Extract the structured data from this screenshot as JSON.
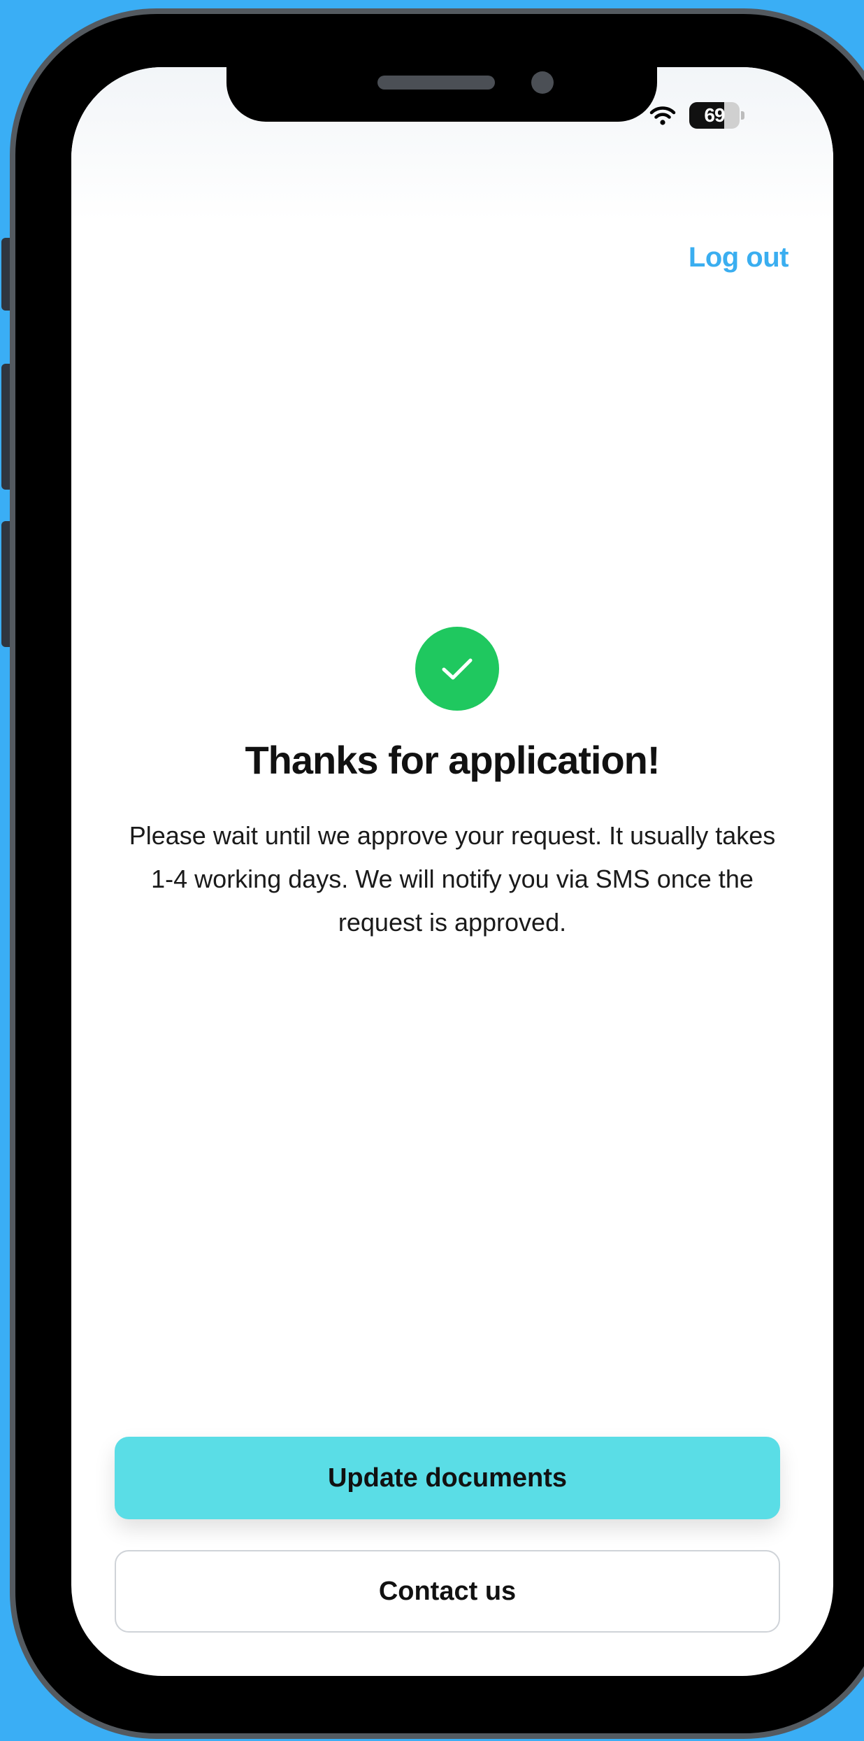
{
  "status_bar": {
    "battery_level": "69",
    "icons": [
      "wifi-icon",
      "battery-icon"
    ]
  },
  "header": {
    "logout_label": "Log out"
  },
  "main": {
    "status_icon": "check-icon",
    "title": "Thanks for application!",
    "message": "Please wait until we approve your request. It usually takes 1-4 working days. We will notify you via SMS once the request is approved."
  },
  "actions": {
    "primary_label": "Update documents",
    "secondary_label": "Contact us"
  },
  "colors": {
    "background": "#3aaef5",
    "accent_link": "#3aaef0",
    "success": "#1fc85f",
    "primary_button": "#5adde6",
    "device_frame": "#000000"
  }
}
